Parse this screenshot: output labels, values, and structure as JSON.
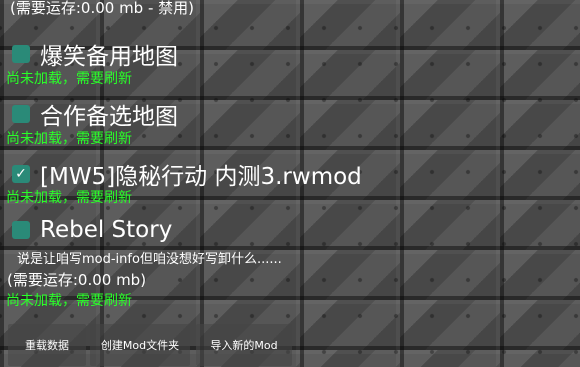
{
  "top_status": "(需要运存:0.00 mb - 禁用)",
  "mods": [
    {
      "title": "爆笑备用地图",
      "status": "尚未加载，需要刷新",
      "checked": false
    },
    {
      "title": "合作备选地图",
      "status": "尚未加载，需要刷新",
      "checked": false
    },
    {
      "title": "[MW5]隐秘行动 内测3.rwmod",
      "status": "尚未加载，需要刷新",
      "checked": true
    },
    {
      "title": "Rebel Story",
      "description": "说是让咱写mod-info但咱没想好写卸什么......",
      "memory": "(需要运存:0.00 mb)",
      "status": "尚未加载，需要刷新",
      "checked": false
    }
  ],
  "toolbar": {
    "reload_label": "重载数据",
    "create_folder_label": "创建Mod文件夹",
    "import_label": "导入新的Mod"
  },
  "colors": {
    "checkbox": "#2a8a78",
    "status_text": "#29ff29",
    "checkmark": "#ffffff"
  }
}
